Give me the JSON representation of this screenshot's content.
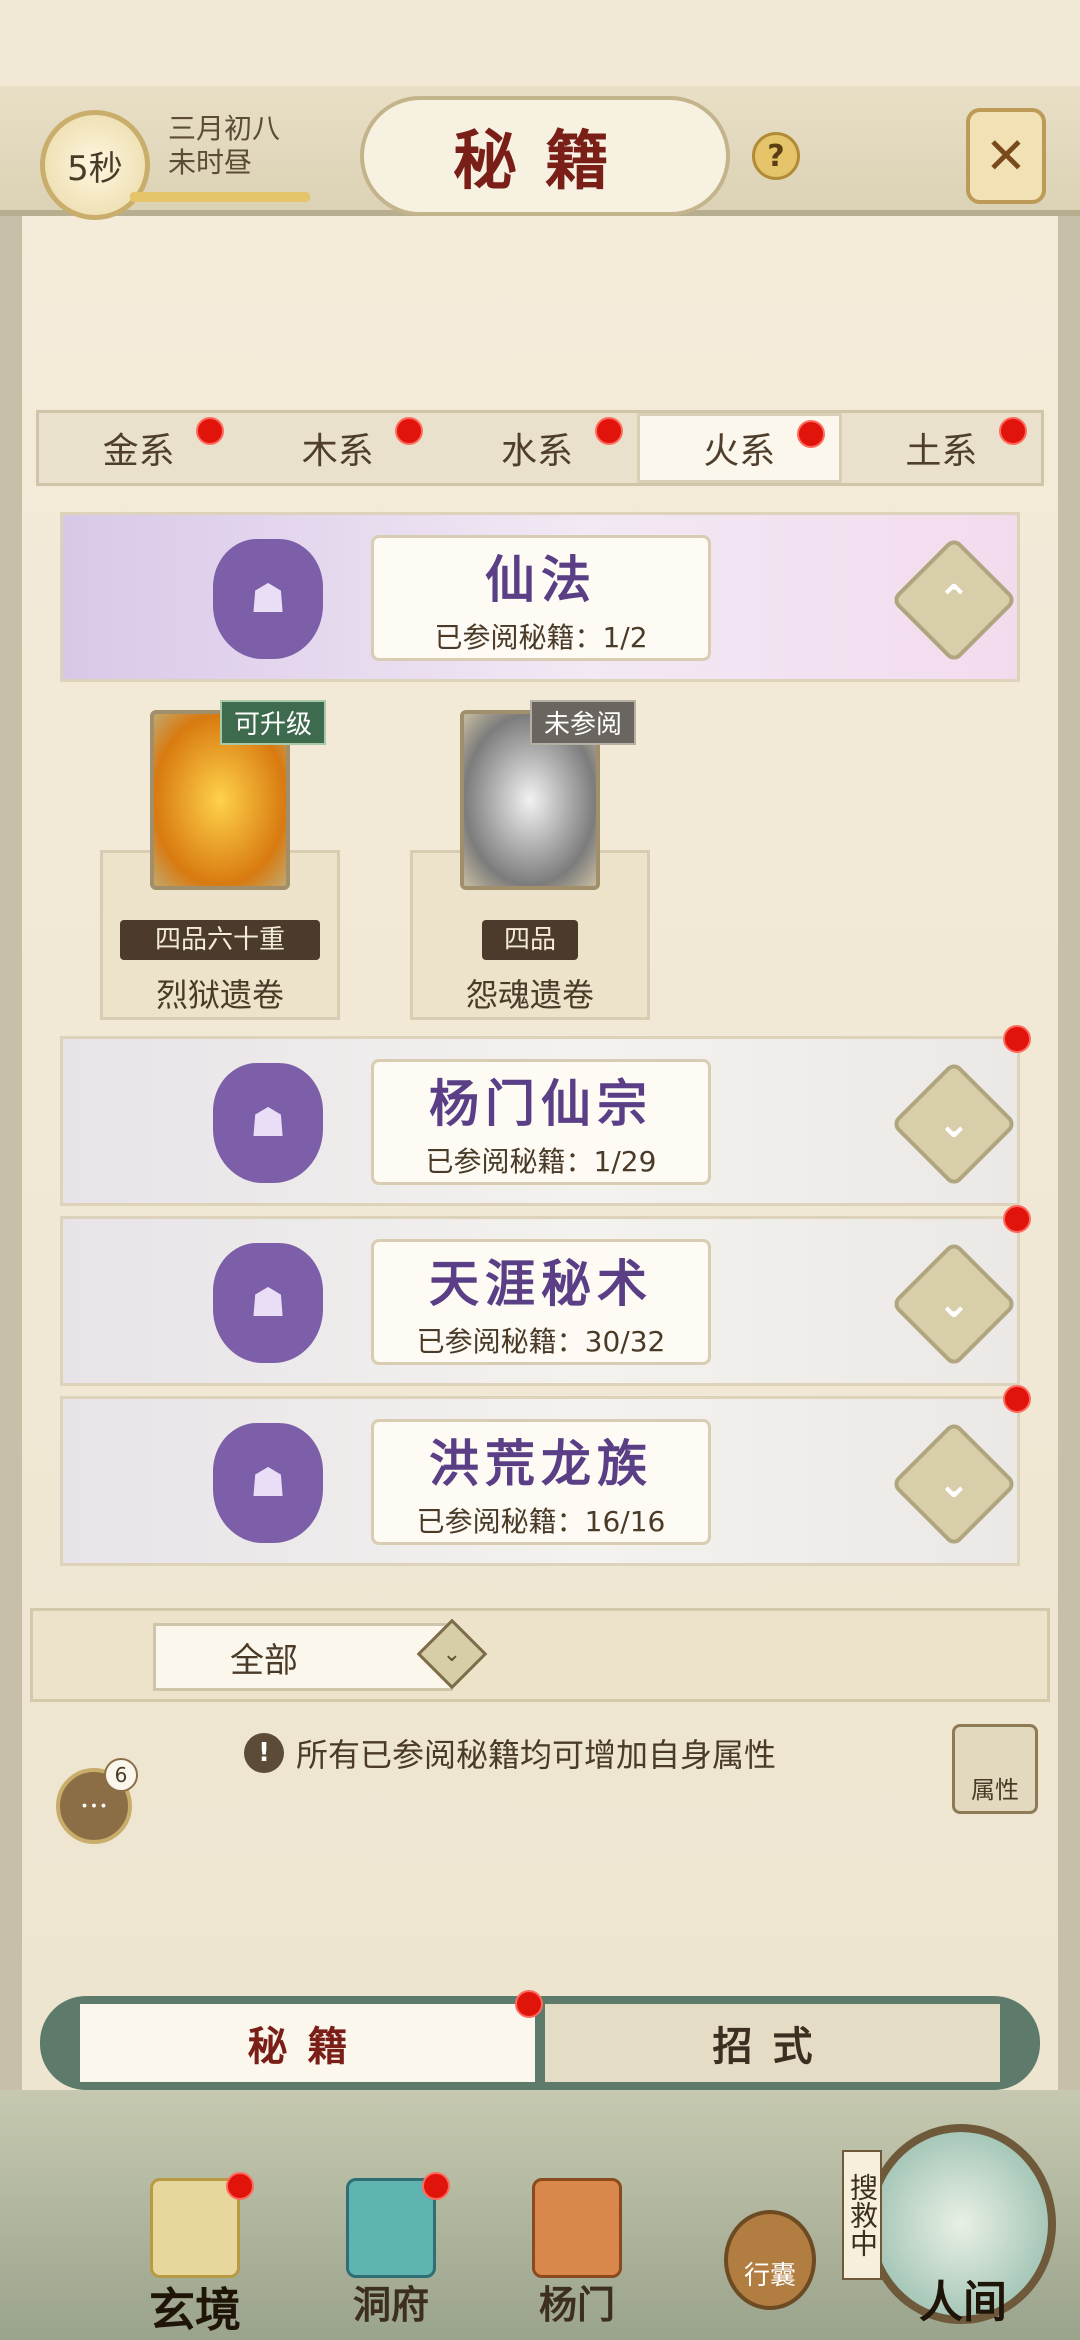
{
  "header": {
    "timer": "5秒",
    "date_line1": "三月初八",
    "date_line2": "未时昼",
    "title": "秘籍",
    "help_glyph": "?",
    "close_glyph": "✕"
  },
  "tabs": [
    {
      "label": "金系",
      "dot": true
    },
    {
      "label": "木系",
      "dot": true
    },
    {
      "label": "水系",
      "dot": true
    },
    {
      "label": "火系",
      "dot": true,
      "active": true
    },
    {
      "label": "土系",
      "dot": true
    }
  ],
  "sections": [
    {
      "name": "仙法",
      "count": "已参阅秘籍：1/2",
      "expanded": true,
      "chevron": "⌃"
    },
    {
      "name": "杨门仙宗",
      "count": "已参阅秘籍：1/29",
      "expanded": false,
      "chevron": "⌄"
    },
    {
      "name": "天涯秘术",
      "count": "已参阅秘籍：30/32",
      "expanded": false,
      "chevron": "⌄"
    },
    {
      "name": "洪荒龙族",
      "count": "已参阅秘籍：16/16",
      "expanded": false,
      "chevron": "⌄"
    }
  ],
  "cards": [
    {
      "tag": "可升级",
      "grade": "四品六十重",
      "name": "烈狱遗卷"
    },
    {
      "tag": "未参阅",
      "grade": "四品",
      "name": "怨魂遗卷"
    }
  ],
  "filter": {
    "label": "全部",
    "chevron": "⌄"
  },
  "notice": {
    "icon": "!",
    "text": "所有已参阅秘籍均可增加自身属性"
  },
  "chat": {
    "icon": "···",
    "badge": "6"
  },
  "attribute": {
    "label": "属性"
  },
  "bottom_tabs": [
    {
      "label": "秘籍",
      "active": true
    },
    {
      "label": "招式"
    }
  ],
  "nav": [
    {
      "label": "玄境"
    },
    {
      "label": "洞府"
    },
    {
      "label": "杨门"
    }
  ],
  "bag": {
    "label": "行囊"
  },
  "world": {
    "label": "人间",
    "status": "搜救中"
  },
  "colors": {
    "accent": "#7a1f18",
    "dot": "#e0140b",
    "purple": "#5a3f86"
  }
}
